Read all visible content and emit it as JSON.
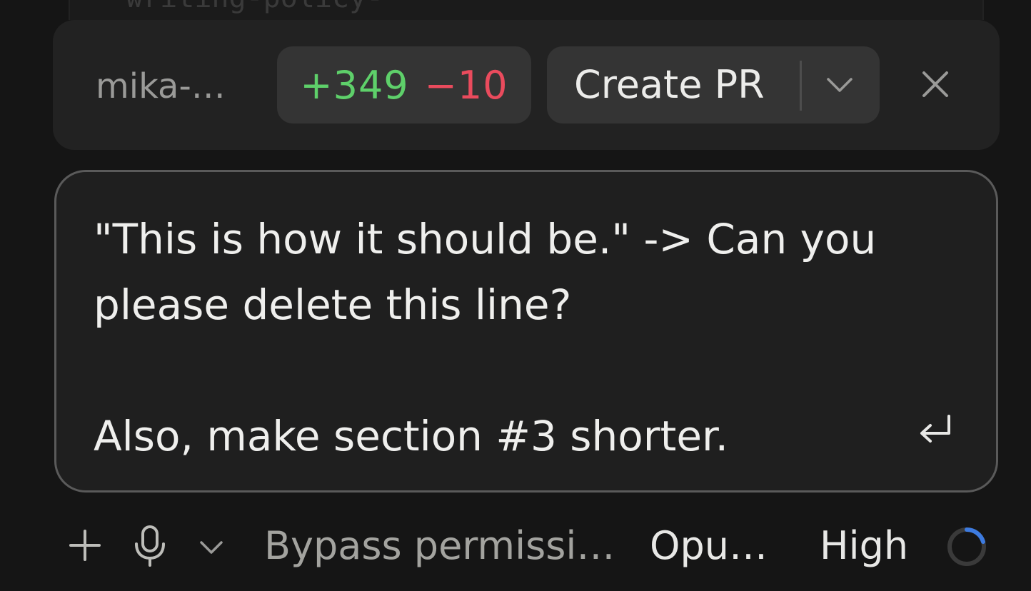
{
  "background_code": "writing-policy-",
  "toolbar": {
    "branch_label": "mika-…",
    "diff": {
      "added": "+349",
      "removed": "−10",
      "added_color": "#5ed06a",
      "removed_color": "#ea4b5d"
    },
    "create_pr_label": "Create PR",
    "icons": {
      "dropdown": "chevron-down-icon",
      "close": "close-icon"
    }
  },
  "prompt": {
    "text": "\"This is how it should be.\" -> Can you\nplease delete this line?\n\nAlso, make section #3 shorter.",
    "submit_icon": "enter-icon"
  },
  "bottom_bar": {
    "icons": {
      "attach": "plus-icon",
      "voice": "microphone-icon",
      "voice_menu": "chevron-down-icon",
      "status": "spinner-icon"
    },
    "permission_mode": "Bypass permissi…",
    "model": "Opu…",
    "effort": "High"
  },
  "colors": {
    "accent": "#3d7be0",
    "panel": "#222222",
    "pill": "#343434"
  }
}
